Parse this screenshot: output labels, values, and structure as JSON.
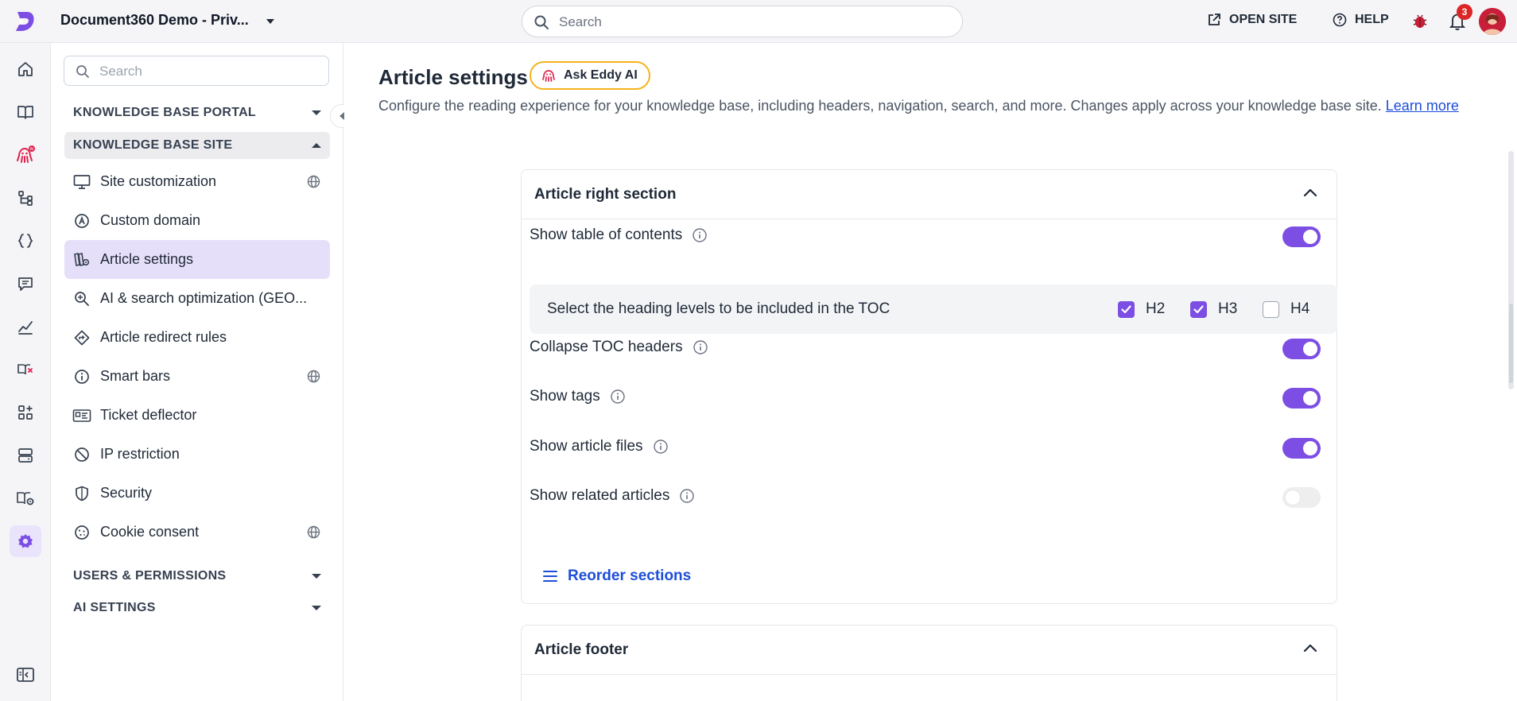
{
  "header": {
    "project_name": "Document360 Demo - Priv...",
    "search_placeholder": "Search",
    "open_site_label": "OPEN SITE",
    "help_label": "HELP",
    "notification_count": "3"
  },
  "rail": {
    "items": [
      "home-icon",
      "book-icon",
      "eddy-ai-icon",
      "workflow-icon",
      "api-icon",
      "feedback-icon",
      "analytics-icon",
      "broken-links-icon",
      "integrations-icon",
      "drive-icon",
      "widget-settings-icon",
      "settings-icon"
    ],
    "active": "settings-icon",
    "bottom": "sidebar-toggle-icon"
  },
  "sidebar": {
    "search_placeholder": "Search",
    "sections": {
      "kb_portal": "KNOWLEDGE BASE PORTAL",
      "kb_site": "KNOWLEDGE BASE SITE",
      "users": "USERS & PERMISSIONS",
      "ai": "AI SETTINGS"
    },
    "items": [
      {
        "label": "Site customization",
        "icon": "monitor-icon",
        "globe": true
      },
      {
        "label": "Custom domain",
        "icon": "domain-icon",
        "globe": false
      },
      {
        "label": "Article settings",
        "icon": "article-settings-icon",
        "globe": false,
        "active": true
      },
      {
        "label": "AI & search optimization (GEO...",
        "icon": "search-optimization-icon",
        "globe": false
      },
      {
        "label": "Article redirect rules",
        "icon": "redirect-icon",
        "globe": false
      },
      {
        "label": "Smart bars",
        "icon": "info-circle-icon",
        "globe": true
      },
      {
        "label": "Ticket deflector",
        "icon": "ticket-deflector-icon",
        "globe": false
      },
      {
        "label": "IP restriction",
        "icon": "ban-icon",
        "globe": false
      },
      {
        "label": "Security",
        "icon": "shield-icon",
        "globe": false
      },
      {
        "label": "Cookie consent",
        "icon": "cookie-icon",
        "globe": true
      }
    ]
  },
  "main": {
    "title": "Article settings",
    "ask_eddy_label": "Ask Eddy AI",
    "description": "Configure the reading experience for your knowledge base, including headers, navigation, search, and more. Changes apply across your knowledge base site. ",
    "learn_more": "Learn more",
    "card1": {
      "title": "Article right section",
      "rows": {
        "toc": {
          "label": "Show table of contents",
          "on": true
        },
        "collapse": {
          "label": "Collapse TOC headers",
          "on": true
        },
        "tags": {
          "label": "Show tags",
          "on": true
        },
        "files": {
          "label": "Show article files",
          "on": true
        },
        "related": {
          "label": "Show related articles",
          "on": false
        }
      },
      "toc_levels_label": "Select the heading levels to be included in the TOC",
      "levels": [
        {
          "label": "H2",
          "checked": true
        },
        {
          "label": "H3",
          "checked": true
        },
        {
          "label": "H4",
          "checked": false
        }
      ],
      "reorder_label": "Reorder sections"
    },
    "card2": {
      "title": "Article footer"
    }
  },
  "colors": {
    "accent": "#7c4ee4",
    "link": "#1d4ed8",
    "eddy_border": "#f5b21a",
    "badge": "#dc2626"
  }
}
